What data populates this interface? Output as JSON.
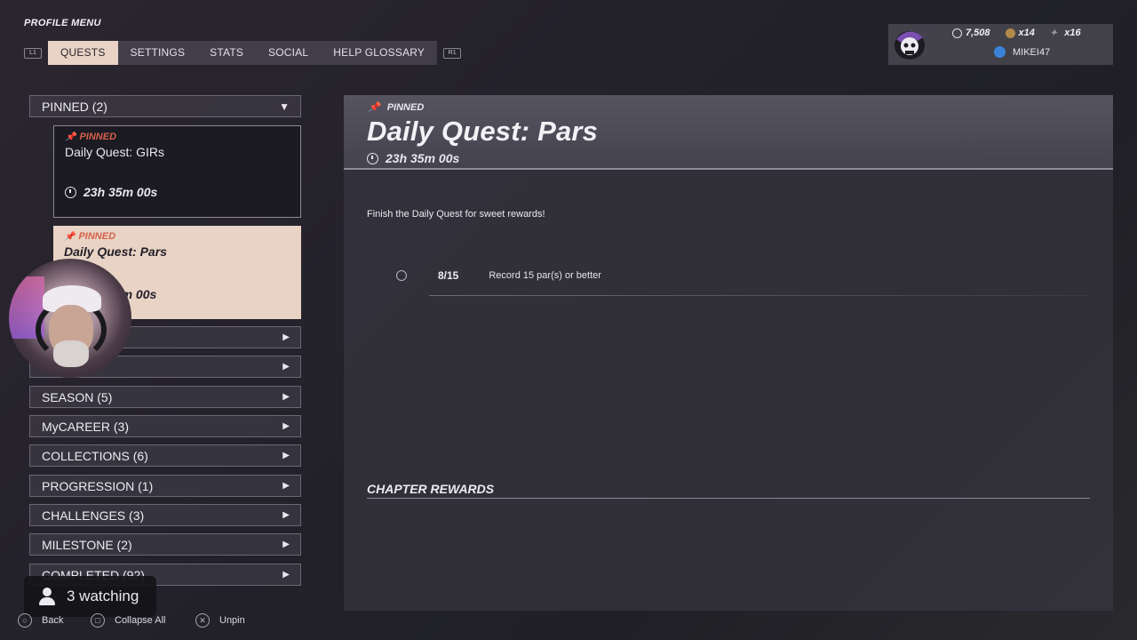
{
  "header": {
    "title": "PROFILE MENU",
    "left_bumper": "L1",
    "right_bumper": "R1",
    "tabs": [
      {
        "label": "QUESTS"
      },
      {
        "label": "SETTINGS"
      },
      {
        "label": "STATS"
      },
      {
        "label": "SOCIAL"
      },
      {
        "label": "HELP GLOSSARY"
      }
    ]
  },
  "hud": {
    "vc": "7,508",
    "item1": "x14",
    "item2": "x16",
    "username": "MIKEI47"
  },
  "sidebar": {
    "pinned_header": "PINNED (2)",
    "pinned_cards": [
      {
        "tag": "PINNED",
        "title": "Daily Quest: GIRs",
        "timer": "23h 35m 00s"
      },
      {
        "tag": "PINNED",
        "title": "Daily Quest: Pars",
        "timer": "23h 35m 00s"
      }
    ],
    "categories": [
      {
        "label": "SEASON (5)"
      },
      {
        "label": "MyCAREER (3)"
      },
      {
        "label": "COLLECTIONS (6)"
      },
      {
        "label": "PROGRESSION (1)"
      },
      {
        "label": "CHALLENGES (3)"
      },
      {
        "label": "MILESTONE (2)"
      },
      {
        "label": "COMPLETED (92)"
      }
    ]
  },
  "detail": {
    "tag": "PINNED",
    "title": "Daily Quest: Pars",
    "timer": "23h 35m 00s",
    "description": "Finish the Daily Quest for sweet rewards!",
    "objectives": [
      {
        "progress": "8/15",
        "text": "Record 15 par(s) or better"
      }
    ],
    "rewards_heading": "CHAPTER REWARDS"
  },
  "overlay": {
    "watching": "3 watching"
  },
  "footer": {
    "back": "Back",
    "collapse_all": "Collapse All",
    "unpin": "Unpin"
  }
}
